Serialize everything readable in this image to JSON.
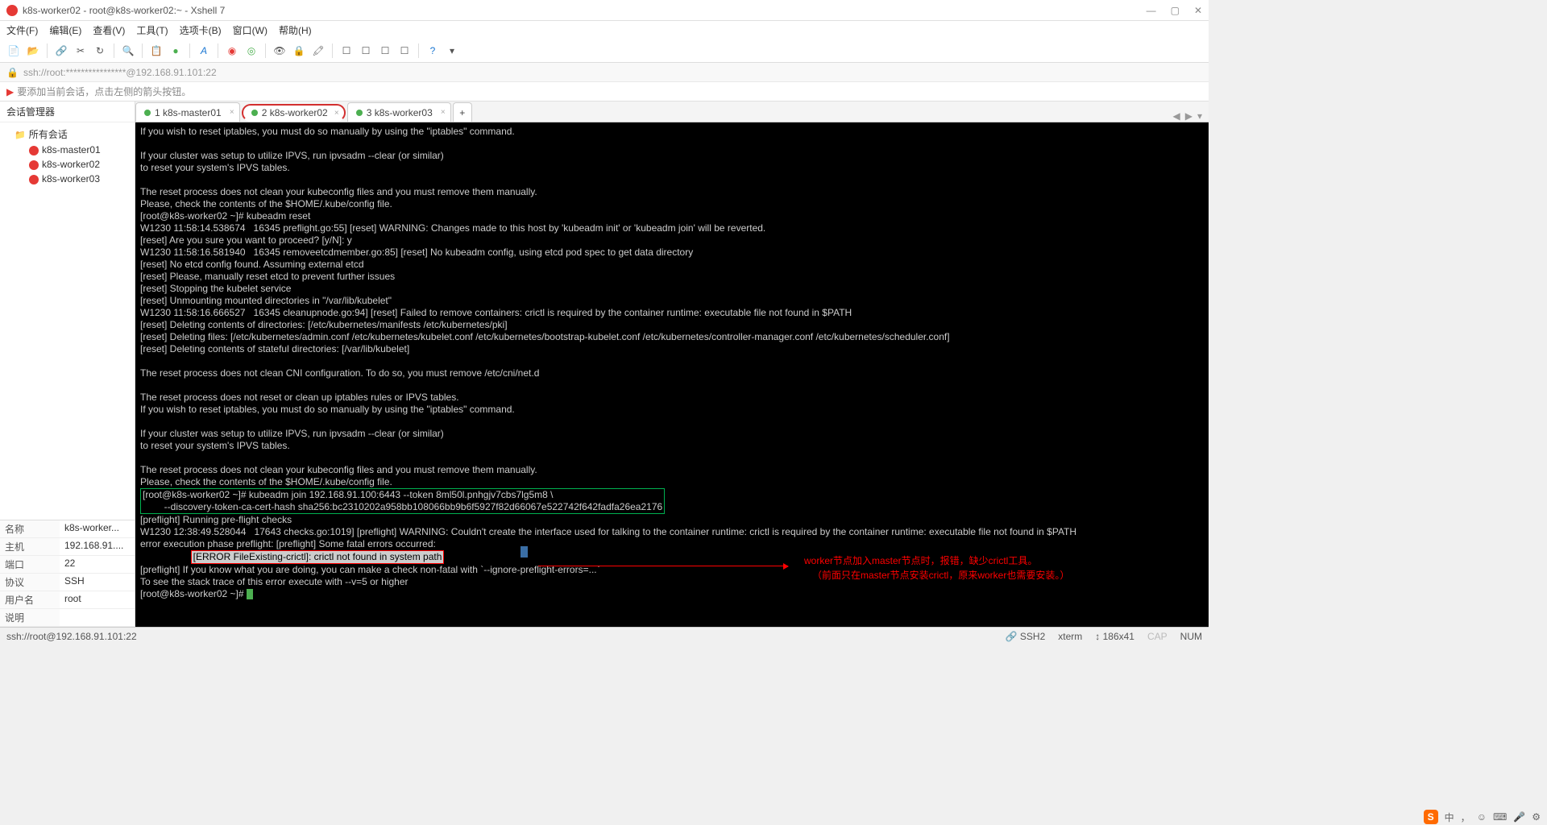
{
  "window": {
    "title": "k8s-worker02 - root@k8s-worker02:~ - Xshell 7",
    "min": "—",
    "max": "▢",
    "close": "✕"
  },
  "menu": {
    "file": "文件(F)",
    "edit": "编辑(E)",
    "view": "查看(V)",
    "tools": "工具(T)",
    "tab": "选项卡(B)",
    "window": "窗口(W)",
    "help": "帮助(H)"
  },
  "address": "ssh://root:****************@192.168.91.101:22",
  "hint": "要添加当前会话，点击左侧的箭头按钮。",
  "sidebar": {
    "title": "会话管理器",
    "root": "所有会话",
    "items": [
      "k8s-master01",
      "k8s-worker02",
      "k8s-worker03"
    ]
  },
  "props": {
    "name_k": "名称",
    "name_v": "k8s-worker...",
    "host_k": "主机",
    "host_v": "192.168.91....",
    "port_k": "端口",
    "port_v": "22",
    "proto_k": "协议",
    "proto_v": "SSH",
    "user_k": "用户名",
    "user_v": "root",
    "desc_k": "说明",
    "desc_v": ""
  },
  "tabs": {
    "t1": "1 k8s-master01",
    "t2": "2 k8s-worker02",
    "t3": "3 k8s-worker03",
    "plus": "+"
  },
  "terminal": {
    "pre1": "If you wish to reset iptables, you must do so manually by using the \"iptables\" command.\n\nIf your cluster was setup to utilize IPVS, run ipvsadm --clear (or similar)\nto reset your system's IPVS tables.\n\nThe reset process does not clean your kubeconfig files and you must remove them manually.\nPlease, check the contents of the $HOME/.kube/config file.\n[root@k8s-worker02 ~]# kubeadm reset\nW1230 11:58:14.538674   16345 preflight.go:55] [reset] WARNING: Changes made to this host by 'kubeadm init' or 'kubeadm join' will be reverted.\n[reset] Are you sure you want to proceed? [y/N]: y\nW1230 11:58:16.581940   16345 removeetcdmember.go:85] [reset] No kubeadm config, using etcd pod spec to get data directory\n[reset] No etcd config found. Assuming external etcd\n[reset] Please, manually reset etcd to prevent further issues\n[reset] Stopping the kubelet service\n[reset] Unmounting mounted directories in \"/var/lib/kubelet\"\nW1230 11:58:16.666527   16345 cleanupnode.go:94] [reset] Failed to remove containers: crictl is required by the container runtime: executable file not found in $PATH\n[reset] Deleting contents of directories: [/etc/kubernetes/manifests /etc/kubernetes/pki]\n[reset] Deleting files: [/etc/kubernetes/admin.conf /etc/kubernetes/kubelet.conf /etc/kubernetes/bootstrap-kubelet.conf /etc/kubernetes/controller-manager.conf /etc/kubernetes/scheduler.conf]\n[reset] Deleting contents of stateful directories: [/var/lib/kubelet]\n\nThe reset process does not clean CNI configuration. To do so, you must remove /etc/cni/net.d\n\nThe reset process does not reset or clean up iptables rules or IPVS tables.\nIf you wish to reset iptables, you must do so manually by using the \"iptables\" command.\n\nIf your cluster was setup to utilize IPVS, run ipvsadm --clear (or similar)\nto reset your system's IPVS tables.\n\nThe reset process does not clean your kubeconfig files and you must remove them manually.\nPlease, check the contents of the $HOME/.kube/config file.",
    "join1": "[root@k8s-worker02 ~]# kubeadm join 192.168.91.100:6443 --token 8ml50l.pnhgjv7cbs7lg5m8 \\",
    "join2": "        --discovery-token-ca-cert-hash sha256:bc2310202a958bb108066bb9b6f5927f82d66067e522742f642fadfa26ea2176",
    "pre2": "[preflight] Running pre-flight checks\nW1230 12:38:49.528044   17643 checks.go:1019] [preflight] WARNING: Couldn't create the interface used for talking to the container runtime: crictl is required by the container runtime: executable file not found in $PATH\nerror execution phase preflight: [preflight] Some fatal errors occurred:",
    "err": "[ERROR FileExisting-crictl]: crictl not found in system path",
    "pre3": "[preflight] If you know what you are doing, you can make a check non-fatal with `--ignore-preflight-errors=...`\nTo see the stack trace of this error execute with --v=5 or higher\n[root@k8s-worker02 ~]# ",
    "anno1": "worker节点加入master节点时，报错，缺少crictl工具。",
    "anno2": "（前面只在master节点安装crictl，原来worker也需要安装。）"
  },
  "status": {
    "addr": "ssh://root@192.168.91.101:22",
    "ssh": "SSH2",
    "term": "xterm",
    "size": "186x41",
    "caps": "CAP",
    "num": "NUM"
  },
  "ime": "中"
}
